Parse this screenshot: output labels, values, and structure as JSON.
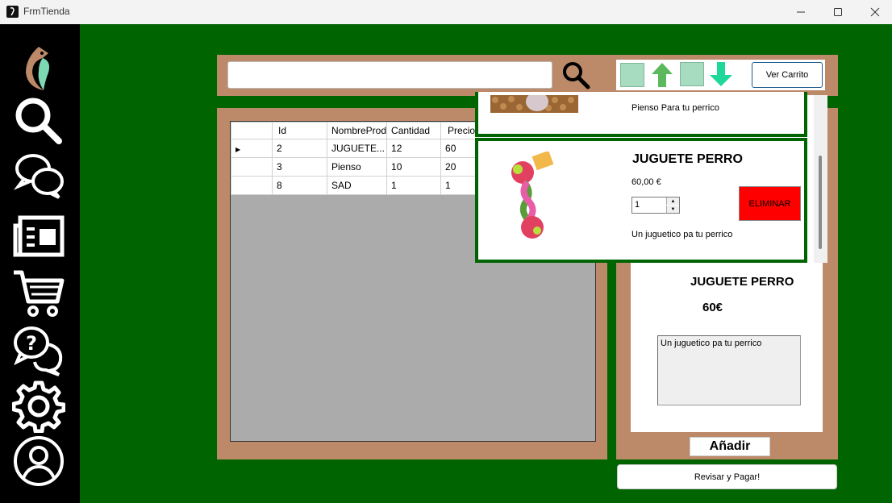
{
  "window": {
    "title": "FrmTienda"
  },
  "search": {
    "value": ""
  },
  "cart_bar": {
    "ver_carrito_label": "Ver Carrito"
  },
  "table": {
    "columns": [
      "Id",
      "NombreProd",
      "Cantidad",
      "Precio"
    ],
    "rows": [
      {
        "id": "2",
        "nombre": "JUGUETE...",
        "cantidad": "12",
        "precio": "60"
      },
      {
        "id": "3",
        "nombre": "Pienso",
        "cantidad": "10",
        "precio": "20"
      },
      {
        "id": "8",
        "nombre": "SAD",
        "cantidad": "1",
        "precio": "1"
      }
    ]
  },
  "cart_popup": {
    "item1": {
      "description": "Pienso Para tu perrico"
    },
    "item2": {
      "name": "JUGUETE PERRO",
      "price": "60,00 €",
      "quantity": "1",
      "remove_label": "ELIMINAR",
      "description": "Un juguetico pa tu perrico"
    }
  },
  "detail": {
    "name": "JUGUETE PERRO",
    "price": "60€",
    "description": "Un juguetico pa tu perrico"
  },
  "actions": {
    "add_label": "Añadir",
    "checkout_label": "Revisar y Pagar!"
  },
  "sidebar": {
    "icons": [
      "logo-icon",
      "search-icon",
      "chat-icon",
      "news-icon",
      "cart-icon",
      "help-icon",
      "settings-icon",
      "user-icon"
    ]
  },
  "colors": {
    "background": "#006400",
    "panel": "#bc8a68",
    "sidebar": "#000000",
    "remove_button": "#ff0000"
  }
}
